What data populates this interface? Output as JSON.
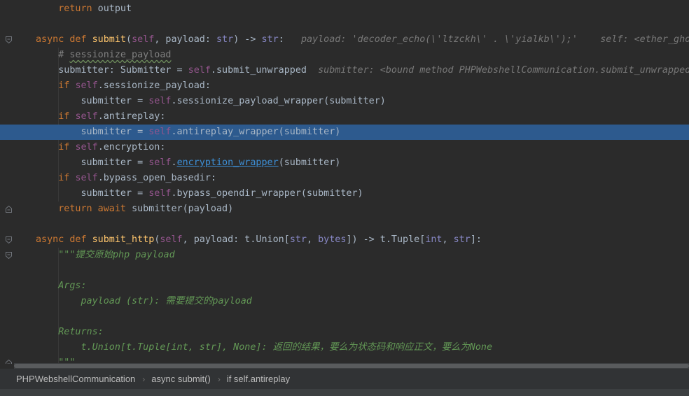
{
  "editor": {
    "lines": [
      [
        [
          "    ",
          "t"
        ],
        [
          "return",
          "kw"
        ],
        [
          " output",
          "t"
        ]
      ],
      [],
      [
        [
          "async def ",
          "kw"
        ],
        [
          "submit",
          "fn"
        ],
        [
          "(",
          "t"
        ],
        [
          "self",
          "self"
        ],
        [
          ", payload: ",
          "t"
        ],
        [
          "str",
          "builtin"
        ],
        [
          ") -> ",
          "t"
        ],
        [
          "str",
          "builtin"
        ],
        [
          ":   ",
          "t"
        ],
        [
          "payload: 'decoder_echo(\\'ltzckh\\' . \\'yialkb\\');'    self: <ether_ghost",
          "hint"
        ]
      ],
      [
        [
          "    ",
          "t"
        ],
        [
          "# ",
          "cmt"
        ],
        [
          "sessionize_payload",
          "cmt typo"
        ]
      ],
      [
        [
          "    submitter: Submitter = ",
          "t"
        ],
        [
          "self",
          "self"
        ],
        [
          ".submit_unwrapped  ",
          "t"
        ],
        [
          "submitter: <bound method PHPWebshellCommunication.submit_unwrapped",
          "hint"
        ]
      ],
      [
        [
          "    ",
          "t"
        ],
        [
          "if ",
          "kw"
        ],
        [
          "self",
          "self"
        ],
        [
          ".sessionize_payload:",
          "t"
        ]
      ],
      [
        [
          "        submitter = ",
          "t"
        ],
        [
          "self",
          "self"
        ],
        [
          ".sessionize_payload_wrapper(submitter)",
          "t"
        ]
      ],
      [
        [
          "    ",
          "t"
        ],
        [
          "if ",
          "kw"
        ],
        [
          "self",
          "self"
        ],
        [
          ".antireplay:",
          "t"
        ]
      ],
      [
        [
          "        submitter = ",
          "t"
        ],
        [
          "self",
          "self"
        ],
        [
          ".antireplay_wrapper(submitter)",
          "t"
        ]
      ],
      [
        [
          "    ",
          "t"
        ],
        [
          "if ",
          "kw"
        ],
        [
          "self",
          "self"
        ],
        [
          ".encryption:",
          "t"
        ]
      ],
      [
        [
          "        submitter = ",
          "t"
        ],
        [
          "self",
          "self"
        ],
        [
          ".",
          "t"
        ],
        [
          "encryption_wrapper",
          "link"
        ],
        [
          "(submitter)",
          "t"
        ]
      ],
      [
        [
          "    ",
          "t"
        ],
        [
          "if ",
          "kw"
        ],
        [
          "self",
          "self"
        ],
        [
          ".bypass_open_basedir:",
          "t"
        ]
      ],
      [
        [
          "        submitter = ",
          "t"
        ],
        [
          "self",
          "self"
        ],
        [
          ".bypass_opendir_wrapper(submitter)",
          "t"
        ]
      ],
      [
        [
          "    ",
          "t"
        ],
        [
          "return await ",
          "kw"
        ],
        [
          "submitter(payload)",
          "t"
        ]
      ],
      [],
      [
        [
          "async def ",
          "kw"
        ],
        [
          "submit_http",
          "fn"
        ],
        [
          "(",
          "t"
        ],
        [
          "self",
          "self"
        ],
        [
          ", payload: t.Union[",
          "t"
        ],
        [
          "str",
          "builtin"
        ],
        [
          ", ",
          "t"
        ],
        [
          "bytes",
          "builtin"
        ],
        [
          "]) -> t.Tuple[",
          "t"
        ],
        [
          "int",
          "builtin"
        ],
        [
          ", ",
          "t"
        ],
        [
          "str",
          "builtin"
        ],
        [
          "]:",
          "t"
        ]
      ],
      [
        [
          "    ",
          "t"
        ],
        [
          "\"\"\"提交原始php payload",
          "doc"
        ]
      ],
      [],
      [
        [
          "    ",
          "t"
        ],
        [
          "Args:",
          "doc"
        ]
      ],
      [
        [
          "        ",
          "t"
        ],
        [
          "payload (str): 需要提交的payload",
          "doc"
        ]
      ],
      [],
      [
        [
          "    ",
          "t"
        ],
        [
          "Returns:",
          "doc"
        ]
      ],
      [
        [
          "        ",
          "t"
        ],
        [
          "t.Union[t.Tuple[int, str], None]: 返回的结果，要么为状态码和响应正文，要么为None",
          "doc"
        ]
      ],
      [
        [
          "    ",
          "t"
        ],
        [
          "\"\"\"",
          "doc"
        ]
      ]
    ],
    "highlighted_line": 8,
    "fold_markers": [
      {
        "line": 2,
        "icon": "fold-open-icon"
      },
      {
        "line": 13,
        "icon": "fold-close-icon"
      },
      {
        "line": 15,
        "icon": "fold-open-icon"
      },
      {
        "line": 16,
        "icon": "fold-open-icon"
      },
      {
        "line": 23,
        "icon": "fold-close-icon"
      }
    ]
  },
  "breadcrumb": {
    "items": [
      "PHPWebshellCommunication",
      "async submit()",
      "if self.antireplay"
    ]
  },
  "colors": {
    "background": "#2b2b2b",
    "selection": "#2d5a8e",
    "keyword": "#cc7832",
    "function": "#ffc66d",
    "self": "#94558d",
    "docstring": "#629755"
  }
}
